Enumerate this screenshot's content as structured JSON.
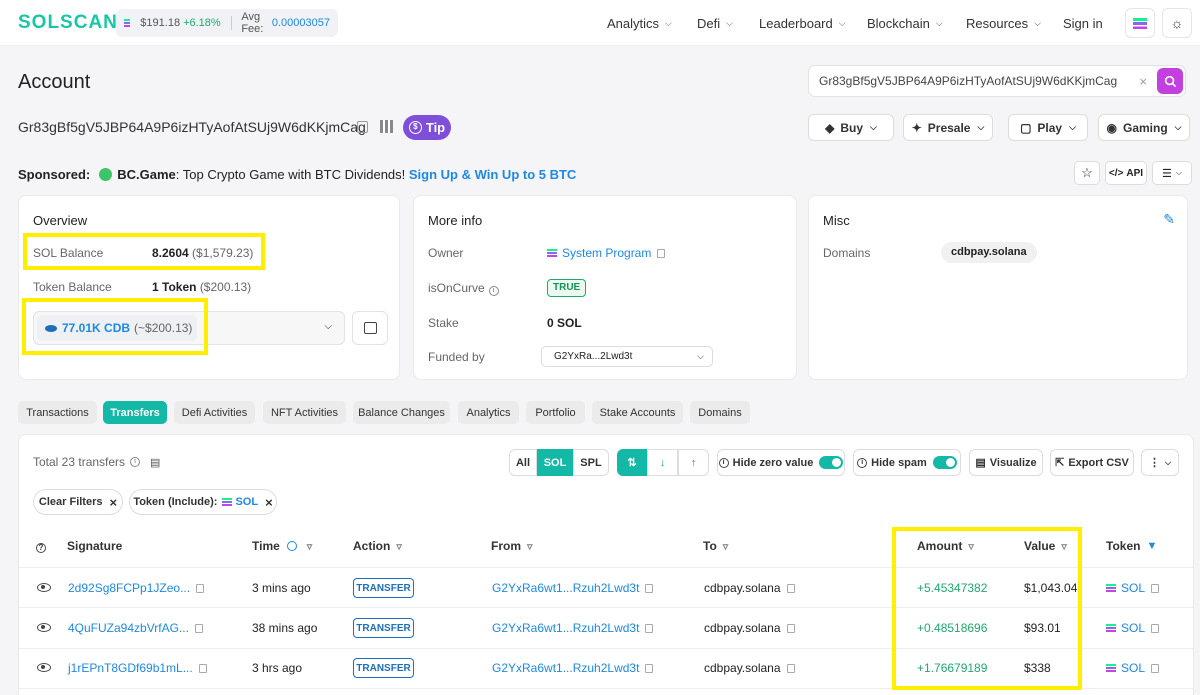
{
  "header": {
    "logo": "SOLSCAN",
    "sol_price": "$191.18",
    "sol_change": "+6.18%",
    "avg_fee_label": "Avg Fee:",
    "avg_fee": "0.00003057",
    "nav": [
      "Analytics",
      "Defi",
      "Leaderboard",
      "Blockchain",
      "Resources"
    ],
    "signin": "Sign in"
  },
  "account": {
    "title": "Account",
    "address": "Gr83gBf5gV5JBP64A9P6izHTyAofAtSUj9W6dKKjmCag",
    "tip": "Tip",
    "search_value": "Gr83gBf5gV5JBP64A9P6izHTyAofAtSUj9W6dKKjmCag"
  },
  "actions": [
    "Buy",
    "Presale",
    "Play",
    "Gaming"
  ],
  "sponsor": {
    "label": "Sponsored:",
    "brand": "BC.Game",
    "text": ": Top Crypto Game with BTC Dividends! ",
    "cta": "Sign Up & Win Up to 5 BTC"
  },
  "api_label": "API",
  "overview": {
    "title": "Overview",
    "sol_balance_label": "SOL Balance",
    "sol_balance": "8.2604",
    "sol_balance_usd": "($1,579.23)",
    "token_balance_label": "Token Balance",
    "token_balance": "1 Token",
    "token_balance_usd": "($200.13)",
    "token_select": "77.01K CDB",
    "token_select_usd": "(~$200.13)"
  },
  "more_info": {
    "title": "More info",
    "owner_label": "Owner",
    "owner": "System Program",
    "oncurve_label": "isOnCurve",
    "oncurve": "TRUE",
    "stake_label": "Stake",
    "stake": "0 SOL",
    "funded_label": "Funded by",
    "funded": "G2YxRa...2Lwd3t"
  },
  "misc": {
    "title": "Misc",
    "domains_label": "Domains",
    "domain": "cdbpay.solana"
  },
  "tabs": [
    "Transactions",
    "Transfers",
    "Defi Activities",
    "NFT Activities",
    "Balance Changes",
    "Analytics",
    "Portfolio",
    "Stake Accounts",
    "Domains"
  ],
  "transfers": {
    "total": "Total 23 transfers",
    "filters": [
      "All",
      "SOL",
      "SPL"
    ],
    "hide_zero": "Hide zero value",
    "hide_spam": "Hide spam",
    "visualize": "Visualize",
    "export": "Export CSV",
    "clear_filters": "Clear Filters",
    "token_include": "Token (Include):",
    "token_include_value": "SOL",
    "columns": [
      "Signature",
      "Time",
      "Action",
      "From",
      "To",
      "Amount",
      "Value",
      "Token"
    ],
    "rows": [
      {
        "signature": "2d92Sg8FCPp1JZeo...",
        "time": "3 mins ago",
        "action": "TRANSFER",
        "from": "G2YxRa6wt1...Rzuh2Lwd3t",
        "to": "cdbpay.solana",
        "amount": "+5.45347382",
        "value": "$1,043.04",
        "token": "SOL"
      },
      {
        "signature": "4QuFUZa94zbVrfAG...",
        "time": "38 mins ago",
        "action": "TRANSFER",
        "from": "G2YxRa6wt1...Rzuh2Lwd3t",
        "to": "cdbpay.solana",
        "amount": "+0.48518696",
        "value": "$93.01",
        "token": "SOL"
      },
      {
        "signature": "j1rEPnT8GDf69b1mL...",
        "time": "3 hrs ago",
        "action": "TRANSFER",
        "from": "G2YxRa6wt1...Rzuh2Lwd3t",
        "to": "cdbpay.solana",
        "amount": "+1.76679189",
        "value": "$338",
        "token": "SOL"
      }
    ]
  },
  "colors": {
    "accent": "#14b8a6",
    "link": "#1e88e5",
    "highlight": "#ffee00",
    "positive": "#1faa6b"
  }
}
